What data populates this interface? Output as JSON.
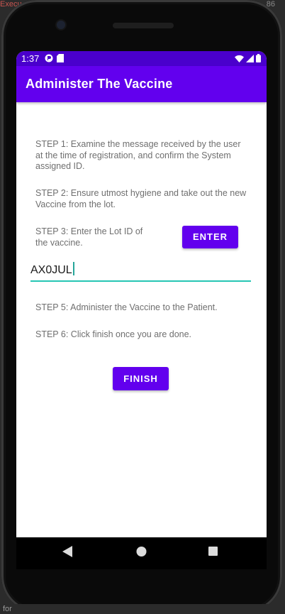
{
  "ide": {
    "top_text": "Execu",
    "top_right_text": "86",
    "bottom_text": "for"
  },
  "status_bar": {
    "time": "1:37",
    "colors": {
      "bar": "#4a00cc"
    }
  },
  "app_bar": {
    "title": "Administer The Vaccine",
    "color": "#6200ee"
  },
  "steps": {
    "step1": "STEP 1: Examine the message received by the user at the time of registration, and confirm the System assigned ID.",
    "step2": "STEP 2: Ensure utmost hygiene and take out the new Vaccine from the lot.",
    "step3": "STEP 3: Enter the Lot ID of the vaccine.",
    "step5": "STEP 5: Administer the Vaccine to the Patient.",
    "step6": "STEP 6: Click finish once you are done."
  },
  "buttons": {
    "enter_label": "ENTER",
    "finish_label": "FINISH"
  },
  "lot_input": {
    "value": "AX0JUL"
  },
  "icons": {
    "status_left": [
      "notification-icon",
      "sd-card-icon"
    ],
    "status_right": [
      "wifi-icon",
      "signal-icon",
      "battery-icon"
    ],
    "nav": [
      "back-icon",
      "home-icon",
      "recents-icon"
    ]
  }
}
